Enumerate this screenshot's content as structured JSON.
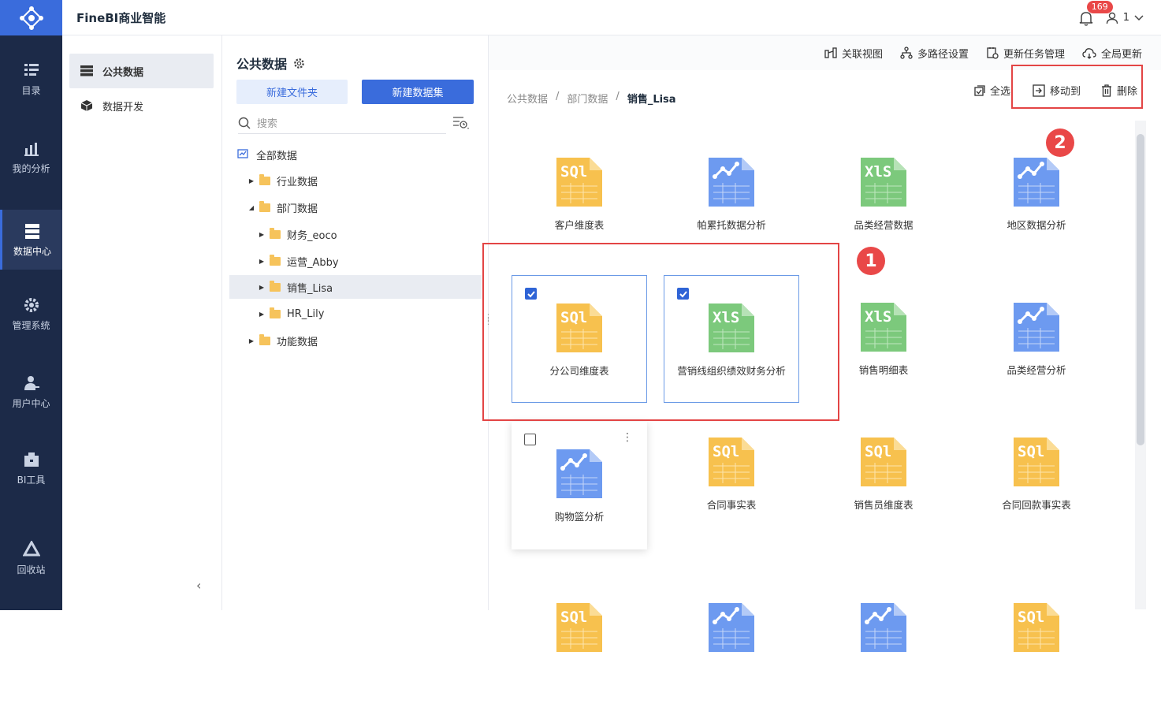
{
  "app": {
    "brand": "FineBI商业智能",
    "notification_count": "169",
    "user": "1"
  },
  "rail": [
    {
      "label": "目录",
      "icon": "catalog-icon"
    },
    {
      "label": "我的分析",
      "icon": "analysis-icon"
    },
    {
      "label": "数据中心",
      "icon": "data-center-icon"
    },
    {
      "label": "管理系统",
      "icon": "gear-icon"
    },
    {
      "label": "用户中心",
      "icon": "user-icon"
    },
    {
      "label": "BI工具",
      "icon": "toolbox-icon"
    },
    {
      "label": "回收站",
      "icon": "recycle-icon"
    }
  ],
  "navcol": {
    "items": [
      {
        "label": "公共数据"
      },
      {
        "label": "数据开发"
      }
    ],
    "collapse": "‹"
  },
  "tree": {
    "title": "公共数据",
    "new_folder": "新建文件夹",
    "new_dataset": "新建数据集",
    "search_placeholder": "搜索",
    "root": "全部数据",
    "rows": [
      {
        "label": "行业数据",
        "caret": "▶"
      },
      {
        "label": "部门数据",
        "caret": "◢"
      },
      {
        "label": "财务_eoco",
        "caret": "▶"
      },
      {
        "label": "运营_Abby",
        "caret": "▶"
      },
      {
        "label": "销售_Lisa",
        "caret": "▶"
      },
      {
        "label": "HR_Lily",
        "caret": "▶"
      },
      {
        "label": "功能数据",
        "caret": "▶"
      }
    ]
  },
  "toolbar": {
    "items": [
      "关联视图",
      "多路径设置",
      "更新任务管理",
      "全局更新"
    ]
  },
  "breadcrumb": {
    "items": [
      "公共数据",
      "部门数据",
      "销售_Lisa"
    ],
    "sep": "/"
  },
  "actions": {
    "select_all": "全选",
    "move_to": "移动到",
    "delete": "删除"
  },
  "markers": {
    "one": "1",
    "two": "2"
  },
  "cards": [
    {
      "label": "客户维度表",
      "type": "sql"
    },
    {
      "label": "帕累托数据分析",
      "type": "analysis"
    },
    {
      "label": "品类经营数据",
      "type": "xls"
    },
    {
      "label": "地区数据分析",
      "type": "analysis"
    },
    {
      "label": "分公司维度表",
      "type": "sql",
      "checked": true
    },
    {
      "label": "营销线组织绩效财务分析",
      "type": "xls",
      "checked": true
    },
    {
      "label": "销售明细表",
      "type": "xls"
    },
    {
      "label": "品类经营分析",
      "type": "analysis"
    },
    {
      "label": "购物篮分析",
      "type": "analysis",
      "checked": false
    },
    {
      "label": "合同事实表",
      "type": "sql"
    },
    {
      "label": "销售员维度表",
      "type": "sql"
    },
    {
      "label": "合同回款事实表",
      "type": "sql"
    },
    {
      "label": "",
      "type": "sql"
    },
    {
      "label": "",
      "type": "analysis"
    },
    {
      "label": "",
      "type": "analysis"
    },
    {
      "label": "",
      "type": "sql"
    }
  ],
  "colors": {
    "rail": "#1c2a48",
    "accent": "#3a6cdc",
    "sql": "#f7c14e",
    "xls": "#7cc97c",
    "analysis": "#6d9af0",
    "highlight": "#e34545"
  }
}
